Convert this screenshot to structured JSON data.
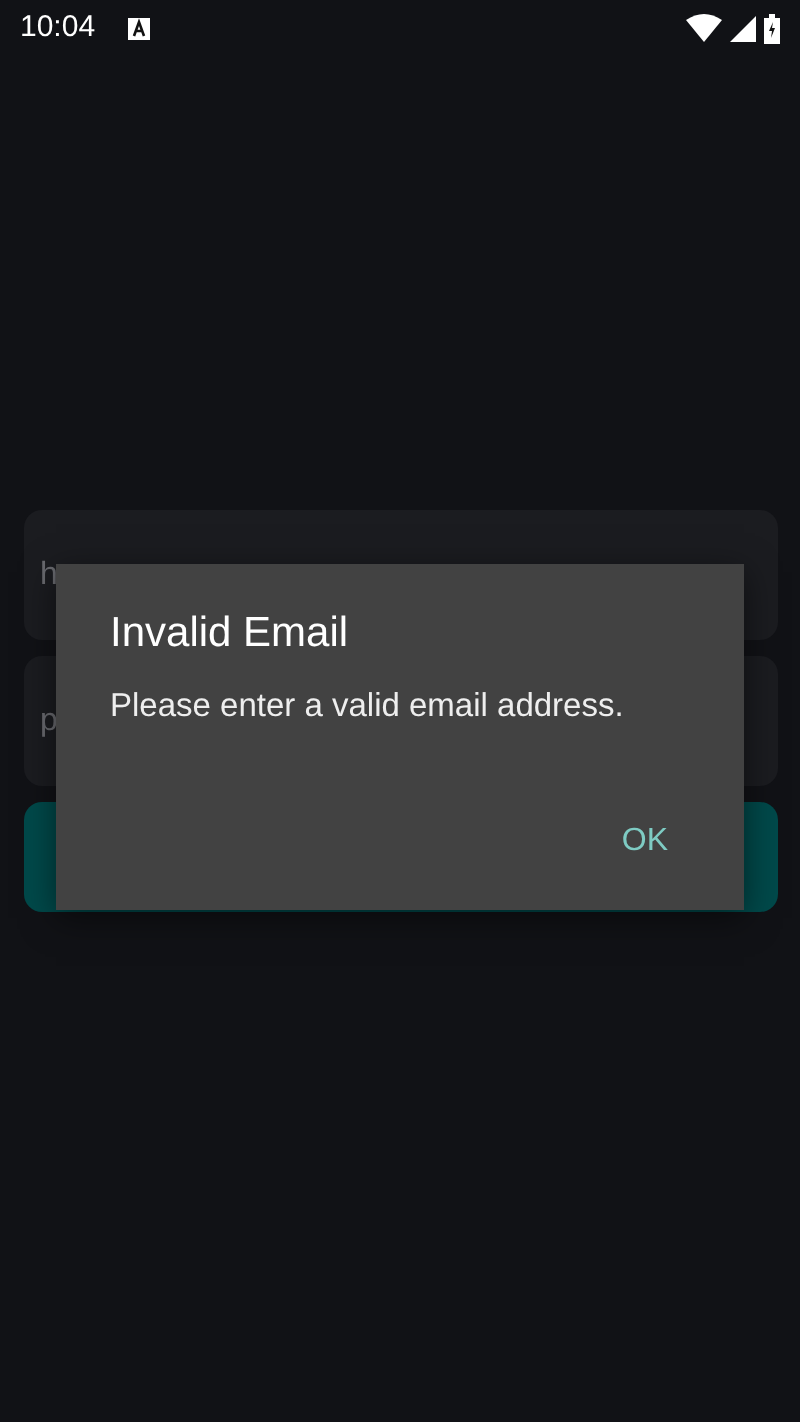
{
  "status_bar": {
    "time": "10:04"
  },
  "form": {
    "fields": [
      {
        "placeholder": "h"
      },
      {
        "placeholder": "p"
      }
    ],
    "button": {
      "kind": "primary"
    }
  },
  "dialog": {
    "title": "Invalid Email",
    "message": "Please enter a valid email address.",
    "buttons": [
      "OK"
    ]
  }
}
